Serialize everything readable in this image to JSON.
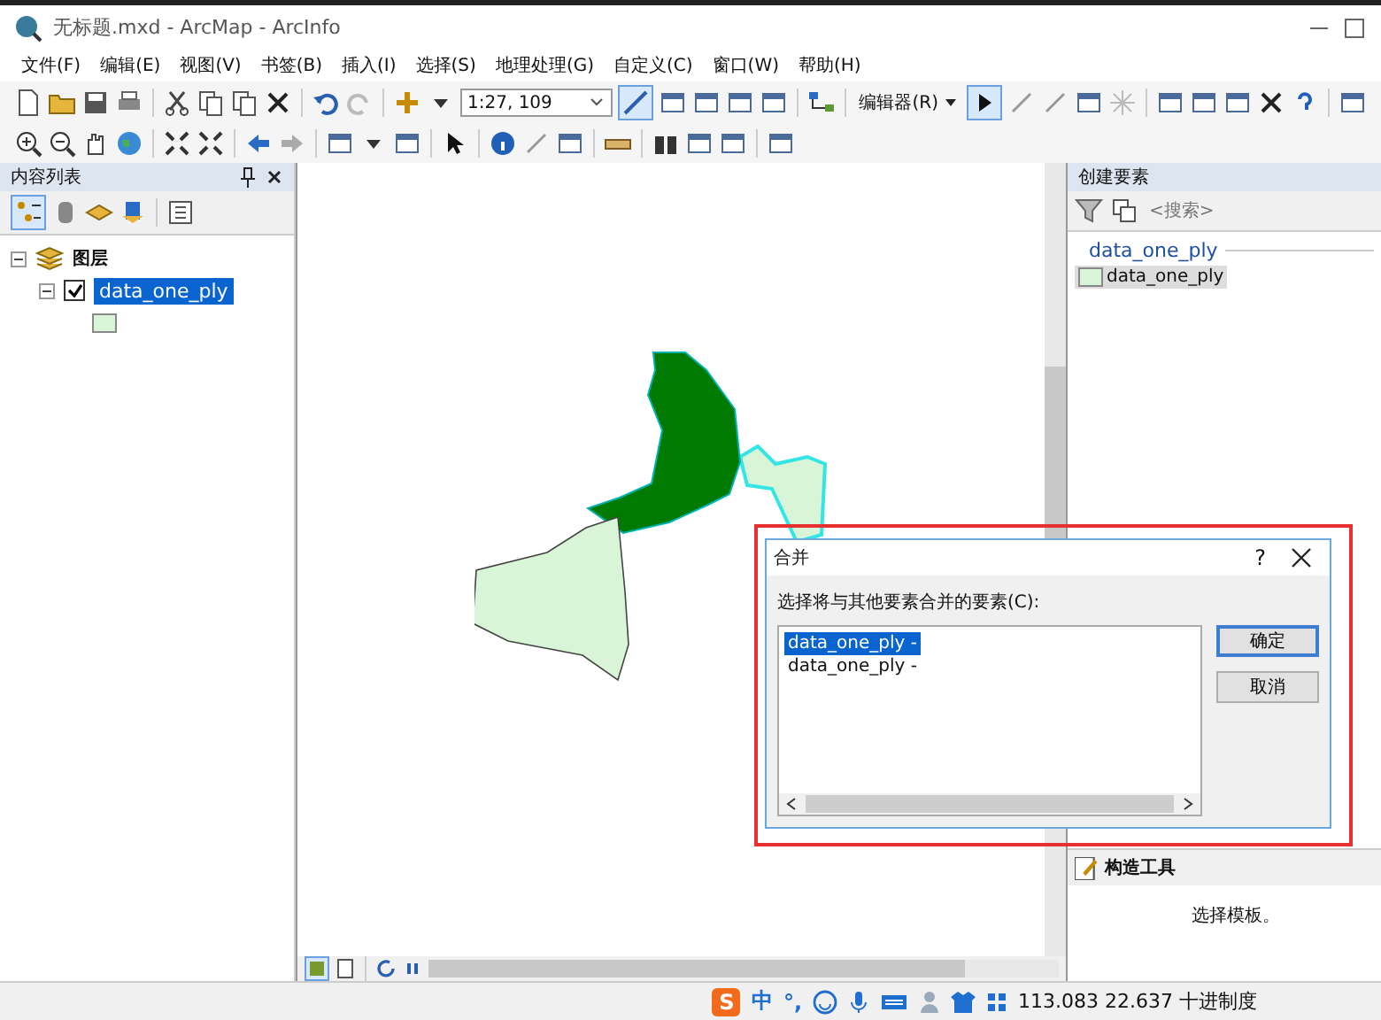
{
  "window": {
    "title": "无标题.mxd - ArcMap - ArcInfo"
  },
  "menu": [
    "文件(F)",
    "编辑(E)",
    "视图(V)",
    "书签(B)",
    "插入(I)",
    "选择(S)",
    "地理处理(G)",
    "自定义(C)",
    "窗口(W)",
    "帮助(H)"
  ],
  "toolbar": {
    "scale": "1:27, 109",
    "editor_menu": "编辑器(R)"
  },
  "toc": {
    "title": "内容列表",
    "tree": [
      {
        "label": "图层",
        "expanded": true,
        "children": [
          {
            "label": "data_one_ply",
            "checked": true,
            "selected": true,
            "expanded": true
          }
        ]
      }
    ]
  },
  "create_features": {
    "title": "创建要素",
    "search_placeholder": "<搜索>",
    "group": "data_one_ply",
    "templates": [
      {
        "label": "data_one_ply",
        "selected": true
      }
    ]
  },
  "construction_tools": {
    "title": "构造工具",
    "message": "选择模板。"
  },
  "dialog": {
    "title": "合并",
    "help": "?",
    "prompt": "选择将与其他要素合并的要素(C):",
    "items": [
      {
        "label": "data_one_ply -",
        "selected": true
      },
      {
        "label": "data_one_ply -",
        "selected": false
      }
    ],
    "buttons": [
      "确定",
      "取消"
    ]
  },
  "status_bar": {
    "ime_logo": "S",
    "ime": "中",
    "ime_punct": "°,",
    "coordinates": "113.083  22.637 十进制度"
  }
}
